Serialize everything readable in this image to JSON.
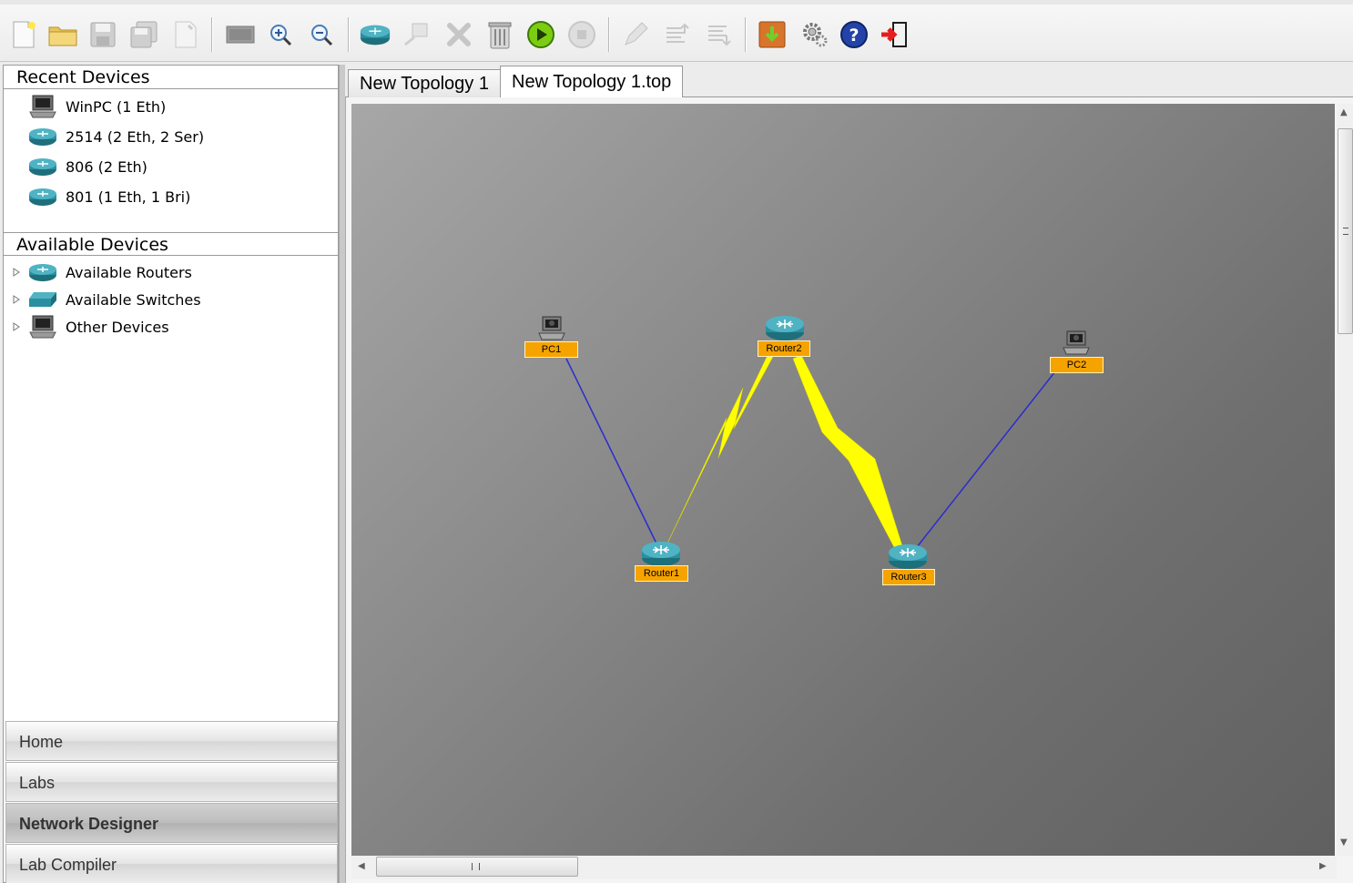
{
  "recent_devices": {
    "header": "Recent Devices",
    "items": [
      {
        "label": "WinPC (1 Eth)",
        "icon": "pc-icon"
      },
      {
        "label": "2514 (2 Eth, 2 Ser)",
        "icon": "router-icon"
      },
      {
        "label": "806 (2 Eth)",
        "icon": "router-icon"
      },
      {
        "label": "801 (1 Eth, 1 Bri)",
        "icon": "router-icon"
      }
    ]
  },
  "available_devices": {
    "header": "Available Devices",
    "items": [
      {
        "label": "Available Routers",
        "icon": "router-icon"
      },
      {
        "label": "Available Switches",
        "icon": "switch-icon"
      },
      {
        "label": "Other Devices",
        "icon": "pc-icon"
      }
    ]
  },
  "nav": {
    "items": [
      {
        "label": "Home"
      },
      {
        "label": "Labs"
      },
      {
        "label": "Network Designer",
        "active": true
      },
      {
        "label": "Lab Compiler"
      }
    ]
  },
  "tabs": [
    {
      "label": "New Topology 1",
      "active": false
    },
    {
      "label": "New Topology 1.top",
      "active": true
    }
  ],
  "topology": {
    "devices": [
      {
        "id": "PC1",
        "label": "PC1",
        "type": "pc"
      },
      {
        "id": "Router2",
        "label": "Router2",
        "type": "router"
      },
      {
        "id": "PC2",
        "label": "PC2",
        "type": "pc"
      },
      {
        "id": "Router1",
        "label": "Router1",
        "type": "router"
      },
      {
        "id": "Router3",
        "label": "Router3",
        "type": "router"
      }
    ],
    "links": [
      {
        "from": "PC1",
        "to": "Router1",
        "kind": "ethernet"
      },
      {
        "from": "Router1",
        "to": "Router2",
        "kind": "serial"
      },
      {
        "from": "Router2",
        "to": "Router3",
        "kind": "serial"
      },
      {
        "from": "Router3",
        "to": "PC2",
        "kind": "ethernet"
      }
    ]
  },
  "colors": {
    "label_bg": "#f6a300",
    "ethernet_link": "#2b2bd0",
    "serial_link": "#ffff00",
    "router": "#2a8fa0"
  }
}
